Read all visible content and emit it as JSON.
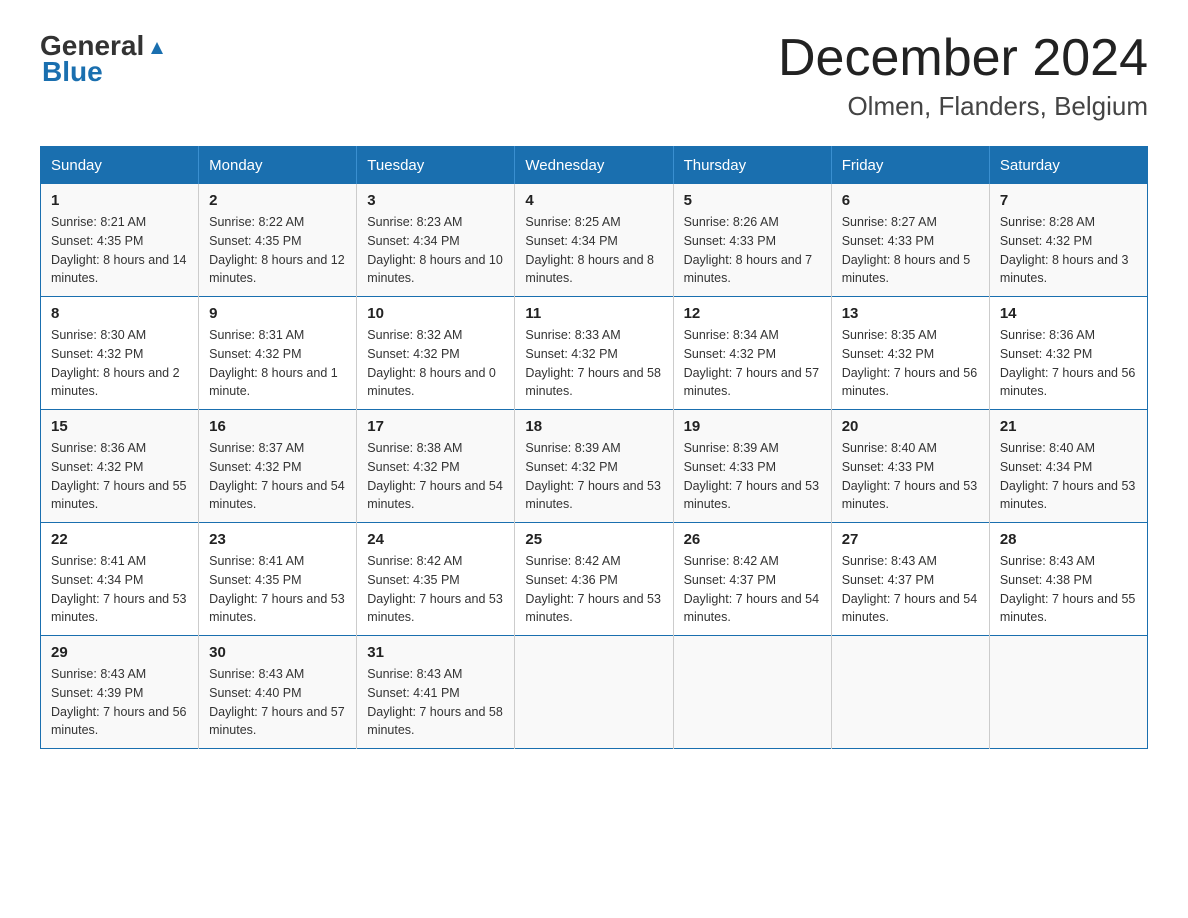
{
  "logo": {
    "line1": "General",
    "line2": "Blue"
  },
  "title": {
    "month": "December 2024",
    "location": "Olmen, Flanders, Belgium"
  },
  "weekdays": [
    "Sunday",
    "Monday",
    "Tuesday",
    "Wednesday",
    "Thursday",
    "Friday",
    "Saturday"
  ],
  "weeks": [
    [
      {
        "day": "1",
        "sunrise": "8:21 AM",
        "sunset": "4:35 PM",
        "daylight": "8 hours and 14 minutes."
      },
      {
        "day": "2",
        "sunrise": "8:22 AM",
        "sunset": "4:35 PM",
        "daylight": "8 hours and 12 minutes."
      },
      {
        "day": "3",
        "sunrise": "8:23 AM",
        "sunset": "4:34 PM",
        "daylight": "8 hours and 10 minutes."
      },
      {
        "day": "4",
        "sunrise": "8:25 AM",
        "sunset": "4:34 PM",
        "daylight": "8 hours and 8 minutes."
      },
      {
        "day": "5",
        "sunrise": "8:26 AM",
        "sunset": "4:33 PM",
        "daylight": "8 hours and 7 minutes."
      },
      {
        "day": "6",
        "sunrise": "8:27 AM",
        "sunset": "4:33 PM",
        "daylight": "8 hours and 5 minutes."
      },
      {
        "day": "7",
        "sunrise": "8:28 AM",
        "sunset": "4:32 PM",
        "daylight": "8 hours and 3 minutes."
      }
    ],
    [
      {
        "day": "8",
        "sunrise": "8:30 AM",
        "sunset": "4:32 PM",
        "daylight": "8 hours and 2 minutes."
      },
      {
        "day": "9",
        "sunrise": "8:31 AM",
        "sunset": "4:32 PM",
        "daylight": "8 hours and 1 minute."
      },
      {
        "day": "10",
        "sunrise": "8:32 AM",
        "sunset": "4:32 PM",
        "daylight": "8 hours and 0 minutes."
      },
      {
        "day": "11",
        "sunrise": "8:33 AM",
        "sunset": "4:32 PM",
        "daylight": "7 hours and 58 minutes."
      },
      {
        "day": "12",
        "sunrise": "8:34 AM",
        "sunset": "4:32 PM",
        "daylight": "7 hours and 57 minutes."
      },
      {
        "day": "13",
        "sunrise": "8:35 AM",
        "sunset": "4:32 PM",
        "daylight": "7 hours and 56 minutes."
      },
      {
        "day": "14",
        "sunrise": "8:36 AM",
        "sunset": "4:32 PM",
        "daylight": "7 hours and 56 minutes."
      }
    ],
    [
      {
        "day": "15",
        "sunrise": "8:36 AM",
        "sunset": "4:32 PM",
        "daylight": "7 hours and 55 minutes."
      },
      {
        "day": "16",
        "sunrise": "8:37 AM",
        "sunset": "4:32 PM",
        "daylight": "7 hours and 54 minutes."
      },
      {
        "day": "17",
        "sunrise": "8:38 AM",
        "sunset": "4:32 PM",
        "daylight": "7 hours and 54 minutes."
      },
      {
        "day": "18",
        "sunrise": "8:39 AM",
        "sunset": "4:32 PM",
        "daylight": "7 hours and 53 minutes."
      },
      {
        "day": "19",
        "sunrise": "8:39 AM",
        "sunset": "4:33 PM",
        "daylight": "7 hours and 53 minutes."
      },
      {
        "day": "20",
        "sunrise": "8:40 AM",
        "sunset": "4:33 PM",
        "daylight": "7 hours and 53 minutes."
      },
      {
        "day": "21",
        "sunrise": "8:40 AM",
        "sunset": "4:34 PM",
        "daylight": "7 hours and 53 minutes."
      }
    ],
    [
      {
        "day": "22",
        "sunrise": "8:41 AM",
        "sunset": "4:34 PM",
        "daylight": "7 hours and 53 minutes."
      },
      {
        "day": "23",
        "sunrise": "8:41 AM",
        "sunset": "4:35 PM",
        "daylight": "7 hours and 53 minutes."
      },
      {
        "day": "24",
        "sunrise": "8:42 AM",
        "sunset": "4:35 PM",
        "daylight": "7 hours and 53 minutes."
      },
      {
        "day": "25",
        "sunrise": "8:42 AM",
        "sunset": "4:36 PM",
        "daylight": "7 hours and 53 minutes."
      },
      {
        "day": "26",
        "sunrise": "8:42 AM",
        "sunset": "4:37 PM",
        "daylight": "7 hours and 54 minutes."
      },
      {
        "day": "27",
        "sunrise": "8:43 AM",
        "sunset": "4:37 PM",
        "daylight": "7 hours and 54 minutes."
      },
      {
        "day": "28",
        "sunrise": "8:43 AM",
        "sunset": "4:38 PM",
        "daylight": "7 hours and 55 minutes."
      }
    ],
    [
      {
        "day": "29",
        "sunrise": "8:43 AM",
        "sunset": "4:39 PM",
        "daylight": "7 hours and 56 minutes."
      },
      {
        "day": "30",
        "sunrise": "8:43 AM",
        "sunset": "4:40 PM",
        "daylight": "7 hours and 57 minutes."
      },
      {
        "day": "31",
        "sunrise": "8:43 AM",
        "sunset": "4:41 PM",
        "daylight": "7 hours and 58 minutes."
      },
      null,
      null,
      null,
      null
    ]
  ]
}
